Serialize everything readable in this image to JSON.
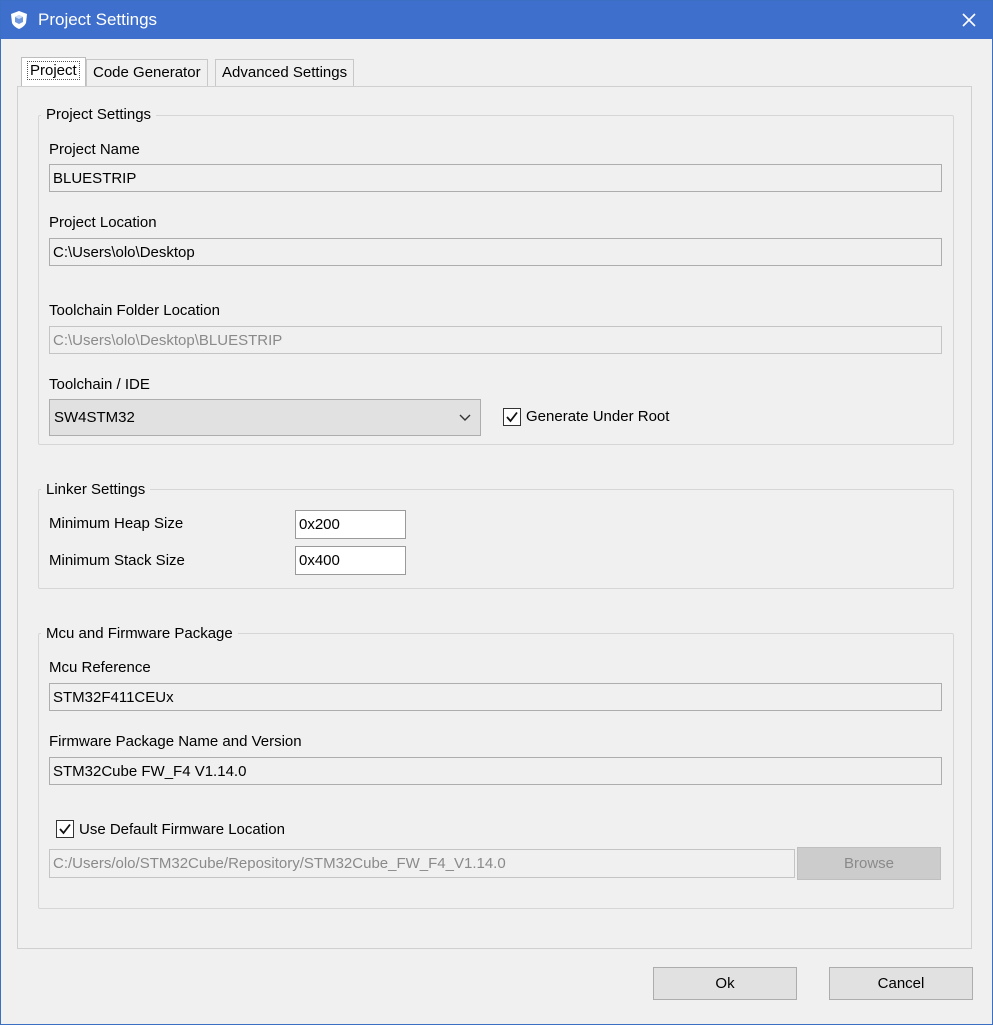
{
  "window": {
    "title": "Project Settings",
    "close_icon": "close-icon",
    "app_icon": "cube-shield-icon"
  },
  "tabs": [
    {
      "label": "Project",
      "active": true
    },
    {
      "label": "Code Generator",
      "active": false
    },
    {
      "label": "Advanced Settings",
      "active": false
    }
  ],
  "project_settings": {
    "legend": "Project Settings",
    "project_name_label": "Project Name",
    "project_name_value": "BLUESTRIP",
    "project_location_label": "Project Location",
    "project_location_value": "C:\\Users\\olo\\Desktop",
    "toolchain_folder_label": "Toolchain Folder Location",
    "toolchain_folder_value": "C:\\Users\\olo\\Desktop\\BLUESTRIP",
    "toolchain_ide_label": "Toolchain / IDE",
    "toolchain_ide_value": "SW4STM32",
    "generate_under_root_label": "Generate Under Root",
    "generate_under_root_checked": true
  },
  "linker_settings": {
    "legend": "Linker Settings",
    "heap_label": "Minimum Heap Size",
    "heap_value": "0x200",
    "stack_label": "Minimum Stack Size",
    "stack_value": "0x400"
  },
  "mcu_firmware": {
    "legend": "Mcu and Firmware Package",
    "mcu_reference_label": "Mcu Reference",
    "mcu_reference_value": "STM32F411CEUx",
    "firmware_label": "Firmware Package Name and Version",
    "firmware_value": "STM32Cube FW_F4 V1.14.0",
    "use_default_label": "Use Default Firmware Location",
    "use_default_checked": true,
    "firmware_location_value": "C:/Users/olo/STM32Cube/Repository/STM32Cube_FW_F4_V1.14.0",
    "browse_label": "Browse"
  },
  "footer": {
    "ok_label": "Ok",
    "cancel_label": "Cancel"
  },
  "colors": {
    "titlebar": "#3f6fcc",
    "window_bg": "#f0f0f0"
  }
}
